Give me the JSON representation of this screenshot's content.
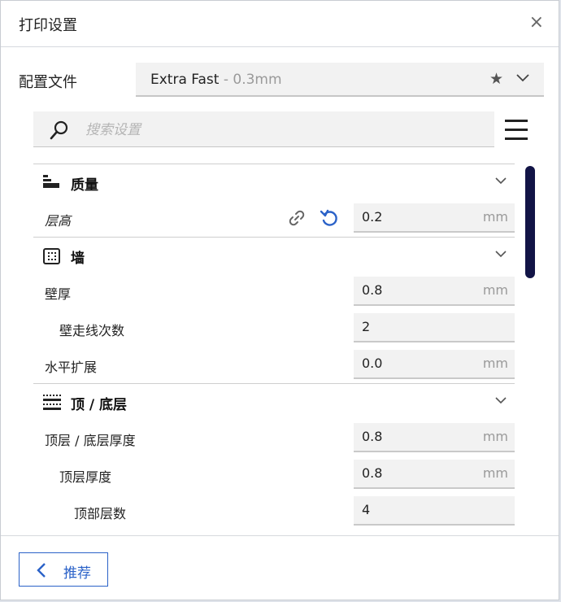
{
  "window": {
    "title": "打印设置",
    "close_icon": "×"
  },
  "profile": {
    "label": "配置文件",
    "name": "Extra Fast",
    "sub": " - 0.3mm"
  },
  "search": {
    "placeholder": "搜索设置",
    "value": ""
  },
  "categories": [
    {
      "label": "质量",
      "icon": "quality-icon",
      "rows": [
        {
          "label": "层高",
          "value": "0.2",
          "unit": "mm",
          "italic": true,
          "has_link": true,
          "has_reset": true
        }
      ]
    },
    {
      "label": "墙",
      "icon": "wall-icon",
      "rows": [
        {
          "label": "壁厚",
          "value": "0.8",
          "unit": "mm"
        },
        {
          "label": "壁走线次数",
          "value": "2",
          "unit": ""
        },
        {
          "label": "水平扩展",
          "value": "0.0",
          "unit": "mm"
        }
      ]
    },
    {
      "label": "顶 / 底层",
      "icon": "top-bottom-icon",
      "rows": [
        {
          "label": "顶层 / 底层厚度",
          "value": "0.8",
          "unit": "mm"
        },
        {
          "label": "顶层厚度",
          "value": "0.8",
          "unit": "mm"
        },
        {
          "label": "顶部层数",
          "value": "4",
          "unit": ""
        }
      ]
    }
  ],
  "footer": {
    "recommended_label": "推荐"
  },
  "colors": {
    "accent": "#2b62c8",
    "reset": "#2b62c8",
    "scrollbar": "#121446"
  }
}
